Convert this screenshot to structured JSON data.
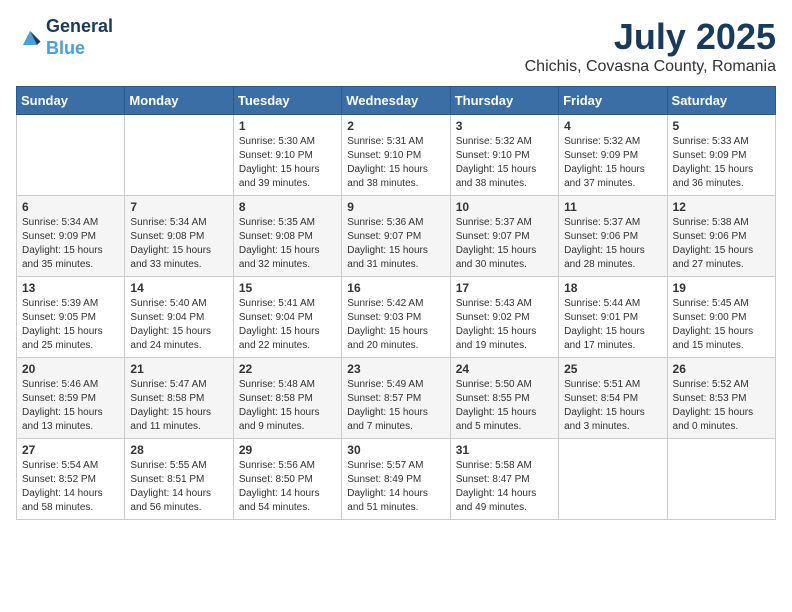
{
  "header": {
    "logo_line1": "General",
    "logo_line2": "Blue",
    "month": "July 2025",
    "location": "Chichis, Covasna County, Romania"
  },
  "weekdays": [
    "Sunday",
    "Monday",
    "Tuesday",
    "Wednesday",
    "Thursday",
    "Friday",
    "Saturday"
  ],
  "weeks": [
    [
      {
        "day": "",
        "content": ""
      },
      {
        "day": "",
        "content": ""
      },
      {
        "day": "1",
        "content": "Sunrise: 5:30 AM\nSunset: 9:10 PM\nDaylight: 15 hours\nand 39 minutes."
      },
      {
        "day": "2",
        "content": "Sunrise: 5:31 AM\nSunset: 9:10 PM\nDaylight: 15 hours\nand 38 minutes."
      },
      {
        "day": "3",
        "content": "Sunrise: 5:32 AM\nSunset: 9:10 PM\nDaylight: 15 hours\nand 38 minutes."
      },
      {
        "day": "4",
        "content": "Sunrise: 5:32 AM\nSunset: 9:09 PM\nDaylight: 15 hours\nand 37 minutes."
      },
      {
        "day": "5",
        "content": "Sunrise: 5:33 AM\nSunset: 9:09 PM\nDaylight: 15 hours\nand 36 minutes."
      }
    ],
    [
      {
        "day": "6",
        "content": "Sunrise: 5:34 AM\nSunset: 9:09 PM\nDaylight: 15 hours\nand 35 minutes."
      },
      {
        "day": "7",
        "content": "Sunrise: 5:34 AM\nSunset: 9:08 PM\nDaylight: 15 hours\nand 33 minutes."
      },
      {
        "day": "8",
        "content": "Sunrise: 5:35 AM\nSunset: 9:08 PM\nDaylight: 15 hours\nand 32 minutes."
      },
      {
        "day": "9",
        "content": "Sunrise: 5:36 AM\nSunset: 9:07 PM\nDaylight: 15 hours\nand 31 minutes."
      },
      {
        "day": "10",
        "content": "Sunrise: 5:37 AM\nSunset: 9:07 PM\nDaylight: 15 hours\nand 30 minutes."
      },
      {
        "day": "11",
        "content": "Sunrise: 5:37 AM\nSunset: 9:06 PM\nDaylight: 15 hours\nand 28 minutes."
      },
      {
        "day": "12",
        "content": "Sunrise: 5:38 AM\nSunset: 9:06 PM\nDaylight: 15 hours\nand 27 minutes."
      }
    ],
    [
      {
        "day": "13",
        "content": "Sunrise: 5:39 AM\nSunset: 9:05 PM\nDaylight: 15 hours\nand 25 minutes."
      },
      {
        "day": "14",
        "content": "Sunrise: 5:40 AM\nSunset: 9:04 PM\nDaylight: 15 hours\nand 24 minutes."
      },
      {
        "day": "15",
        "content": "Sunrise: 5:41 AM\nSunset: 9:04 PM\nDaylight: 15 hours\nand 22 minutes."
      },
      {
        "day": "16",
        "content": "Sunrise: 5:42 AM\nSunset: 9:03 PM\nDaylight: 15 hours\nand 20 minutes."
      },
      {
        "day": "17",
        "content": "Sunrise: 5:43 AM\nSunset: 9:02 PM\nDaylight: 15 hours\nand 19 minutes."
      },
      {
        "day": "18",
        "content": "Sunrise: 5:44 AM\nSunset: 9:01 PM\nDaylight: 15 hours\nand 17 minutes."
      },
      {
        "day": "19",
        "content": "Sunrise: 5:45 AM\nSunset: 9:00 PM\nDaylight: 15 hours\nand 15 minutes."
      }
    ],
    [
      {
        "day": "20",
        "content": "Sunrise: 5:46 AM\nSunset: 8:59 PM\nDaylight: 15 hours\nand 13 minutes."
      },
      {
        "day": "21",
        "content": "Sunrise: 5:47 AM\nSunset: 8:58 PM\nDaylight: 15 hours\nand 11 minutes."
      },
      {
        "day": "22",
        "content": "Sunrise: 5:48 AM\nSunset: 8:58 PM\nDaylight: 15 hours\nand 9 minutes."
      },
      {
        "day": "23",
        "content": "Sunrise: 5:49 AM\nSunset: 8:57 PM\nDaylight: 15 hours\nand 7 minutes."
      },
      {
        "day": "24",
        "content": "Sunrise: 5:50 AM\nSunset: 8:55 PM\nDaylight: 15 hours\nand 5 minutes."
      },
      {
        "day": "25",
        "content": "Sunrise: 5:51 AM\nSunset: 8:54 PM\nDaylight: 15 hours\nand 3 minutes."
      },
      {
        "day": "26",
        "content": "Sunrise: 5:52 AM\nSunset: 8:53 PM\nDaylight: 15 hours\nand 0 minutes."
      }
    ],
    [
      {
        "day": "27",
        "content": "Sunrise: 5:54 AM\nSunset: 8:52 PM\nDaylight: 14 hours\nand 58 minutes."
      },
      {
        "day": "28",
        "content": "Sunrise: 5:55 AM\nSunset: 8:51 PM\nDaylight: 14 hours\nand 56 minutes."
      },
      {
        "day": "29",
        "content": "Sunrise: 5:56 AM\nSunset: 8:50 PM\nDaylight: 14 hours\nand 54 minutes."
      },
      {
        "day": "30",
        "content": "Sunrise: 5:57 AM\nSunset: 8:49 PM\nDaylight: 14 hours\nand 51 minutes."
      },
      {
        "day": "31",
        "content": "Sunrise: 5:58 AM\nSunset: 8:47 PM\nDaylight: 14 hours\nand 49 minutes."
      },
      {
        "day": "",
        "content": ""
      },
      {
        "day": "",
        "content": ""
      }
    ]
  ]
}
